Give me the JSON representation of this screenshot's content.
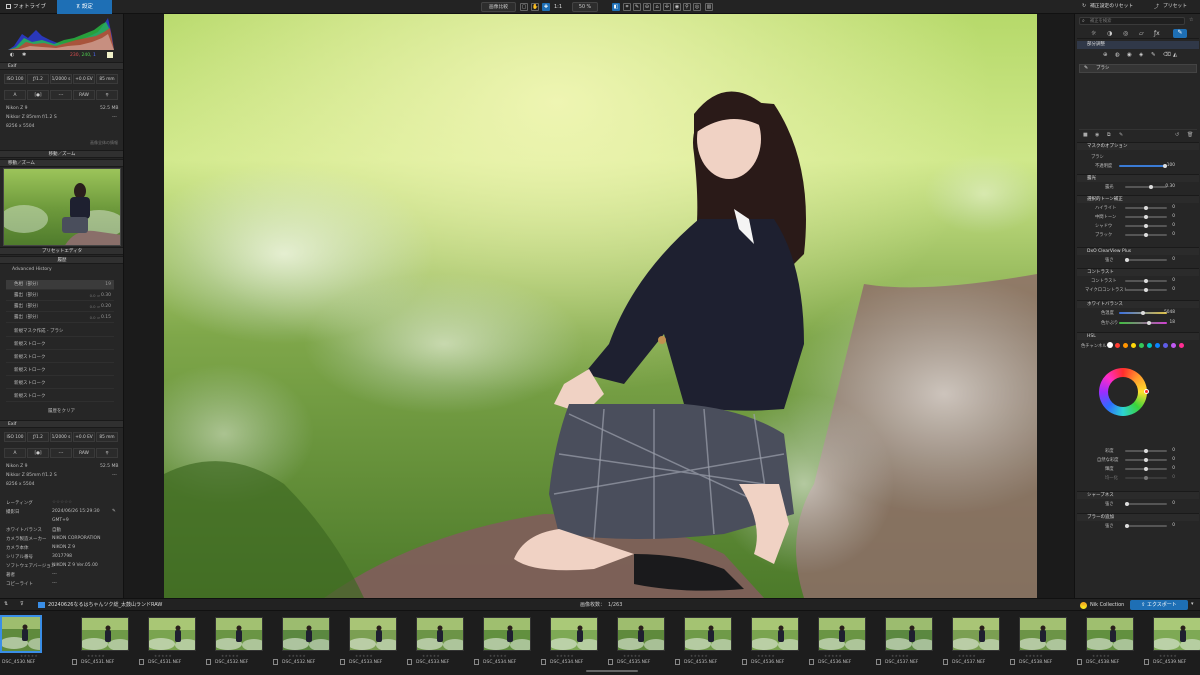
{
  "topbar": {
    "library_tab": "フォトライブラリ",
    "settings_tab": "設定",
    "compare_button": "画像比較",
    "zoom_1to1": "1:1",
    "zoom_percent": "50 %",
    "reset_button": "補正設定のリセット",
    "preset_button": "プリセット"
  },
  "left": {
    "histogram_values": {
      "r": "230,",
      "g": "240,",
      "b": "1"
    },
    "exif1": {
      "title": "Exif",
      "iso": "ISO 100",
      "aperture": "ƒ/1.2",
      "shutter": "1/2000 s",
      "ev": "+0.0 EV",
      "focal": "85 mm",
      "mode": "A",
      "metering": "[●]",
      "dash": "---",
      "format": "RAW",
      "camera": "Nikon Z 9",
      "size_mb": "52.5 MB",
      "lens": "Nikkor Z 85mm f/1.2 S",
      "lens_dash": "---",
      "dims": "8256 x 5504",
      "extra": "画像全体の情報"
    },
    "move_zoom": "移動／ズーム",
    "preset_editor": "プリセットエディタ",
    "history": {
      "title": "履歴",
      "advanced": "Advanced History",
      "items": [
        {
          "label": "色相（部分）",
          "sub": "",
          "val": "19"
        },
        {
          "label": "露出（部分）",
          "sub": "0.0 ⇒",
          "val": "0.30"
        },
        {
          "label": "露出（部分）",
          "sub": "0.0 ⇒",
          "val": "0.20"
        },
        {
          "label": "露出（部分）",
          "sub": "0.0 ⇒",
          "val": "0.15"
        },
        {
          "label": "新規マスク作成 - ブラシ",
          "sub": "",
          "val": ""
        },
        {
          "label": "新規ストローク",
          "sub": "",
          "val": ""
        },
        {
          "label": "新規ストローク",
          "sub": "",
          "val": ""
        },
        {
          "label": "新規ストローク",
          "sub": "",
          "val": ""
        },
        {
          "label": "新規ストローク",
          "sub": "",
          "val": ""
        },
        {
          "label": "新規ストローク",
          "sub": "",
          "val": ""
        }
      ],
      "clear": "履歴をクリア"
    },
    "exif2": {
      "title": "Exif",
      "iso": "ISO 100",
      "aperture": "ƒ/1.2",
      "shutter": "1/2000 s",
      "ev": "+0.0 EV",
      "focal": "85 mm",
      "mode": "A",
      "metering": "[●]",
      "dash": "---",
      "format": "RAW",
      "camera": "Nikon Z 9",
      "size_mb": "52.5 MB",
      "lens": "Nikkor Z 85mm f/1.2 S",
      "lens_dash": "---",
      "dims": "8256 x 5504"
    },
    "meta": [
      {
        "k": "レーティング",
        "v": "☆☆☆☆☆"
      },
      {
        "k": "撮影日",
        "v": "2024/06/26 15:29:30"
      },
      {
        "k": "",
        "v": "GMT+9"
      },
      {
        "k": "ホワイトバランス",
        "v": "自動"
      },
      {
        "k": "カメラ製造メーカー",
        "v": "NIKON CORPORATION"
      },
      {
        "k": "カメラ本体",
        "v": "NIKON Z 9"
      },
      {
        "k": "シリアル番号",
        "v": "3017798"
      },
      {
        "k": "ソフトウェアバージョン",
        "v": "NIKON Z 9 Ver.05.00"
      },
      {
        "k": "著者",
        "v": "---"
      },
      {
        "k": "コピーライト",
        "v": "---"
      }
    ]
  },
  "right": {
    "search_placeholder": "補正を検索",
    "local_adj": "部分調整",
    "brush": "ブラシ",
    "mask_options": "マスクのオプション",
    "brush_sub": "ブラシ",
    "opacity_label": "不透明度",
    "opacity_val": "100",
    "exposure_head": "露光",
    "exposure_label": "露光",
    "exposure_val": "0.30",
    "tone_head": "選択的トーン補正",
    "highlight": "ハイライト",
    "midtone": "中間トーン",
    "shadow": "シャドウ",
    "black": "ブラック",
    "tone_vals": [
      "0",
      "0",
      "0",
      "0"
    ],
    "clearview": "DxO ClearView Plus",
    "clearview_label": "強さ",
    "clearview_val": "0",
    "contrast_head": "コントラスト",
    "contrast_label": "コントラスト",
    "micro_label": "マイクロコントラスト",
    "contrast_vals": [
      "0",
      "0"
    ],
    "wb_head": "ホワイトバランス",
    "temp_label": "色温度",
    "temp_val": "5048",
    "tint_label": "色かぶり",
    "tint_val": "18",
    "hsl_head": "HSL",
    "channel_label": "色チャンネル",
    "hsl_rows": [
      "彩度",
      "自然な彩度",
      "輝度",
      "均一化"
    ],
    "hsl_vals": [
      "0",
      "0",
      "0",
      "0"
    ],
    "sharp_head": "シャープネス",
    "sharp_label": "強さ",
    "sharp_val": "0",
    "blur_head": "ブラーの追加",
    "blur_label": "強さ",
    "blur_val": "0",
    "channel_colors": [
      "#ffffff",
      "#ff3b30",
      "#ff9500",
      "#ffd60a",
      "#34c759",
      "#00c7be",
      "#0a84ff",
      "#5e5ce6",
      "#bf5af2",
      "#ff2d92"
    ]
  },
  "film": {
    "folder": "20240626なるはちゃんツク総_太鼓山ランドRAW",
    "count_label": "画像枚数：",
    "count": "1/263",
    "nik": "Nik Collection",
    "export": "エクスポート",
    "thumbs": [
      "DSC_4530.NEF",
      "DSC_4531.NEF",
      "DSC_4531.NEF",
      "DSC_4532.NEF",
      "DSC_4532.NEF",
      "DSC_4533.NEF",
      "DSC_4533.NEF",
      "DSC_4534.NEF",
      "DSC_4534.NEF",
      "DSC_4535.NEF",
      "DSC_4535.NEF",
      "DSC_4536.NEF",
      "DSC_4536.NEF",
      "DSC_4537.NEF",
      "DSC_4537.NEF",
      "DSC_4538.NEF",
      "DSC_4538.NEF",
      "DSC_4539.NEF"
    ]
  },
  "colors": {
    "accent": "#1e6fb5"
  }
}
